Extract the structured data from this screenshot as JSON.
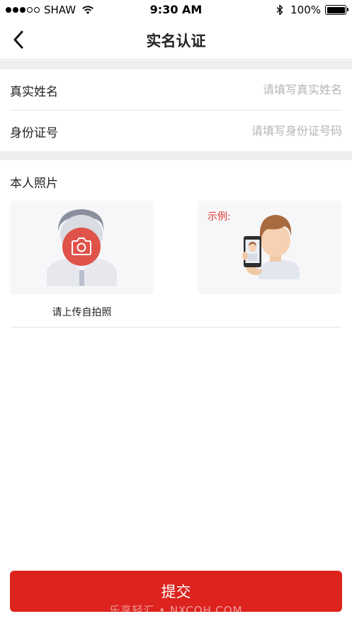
{
  "status_bar": {
    "carrier": "SHAW",
    "time": "9:30 AM",
    "battery": "100%"
  },
  "nav": {
    "title": "实名认证"
  },
  "form": {
    "name": {
      "label": "真实姓名",
      "placeholder": "请填写真实姓名",
      "value": ""
    },
    "id_number": {
      "label": "身份证号",
      "placeholder": "请填写身份证号码",
      "value": ""
    }
  },
  "photo": {
    "section_title": "本人照片",
    "upload_caption": "请上传自拍照",
    "example_label": "示例:"
  },
  "submit": {
    "label": "提交"
  },
  "watermark": "乐享轻汇 • NXCOH.COM",
  "colors": {
    "accent": "#dc231e",
    "example_text": "#e0342e",
    "background_band": "#efefef"
  },
  "icons": [
    "signal-dots-icon",
    "wifi-icon",
    "bluetooth-icon",
    "battery-icon",
    "back-arrow-icon",
    "camera-icon",
    "avatar-placeholder-icon",
    "selfie-example-icon"
  ]
}
